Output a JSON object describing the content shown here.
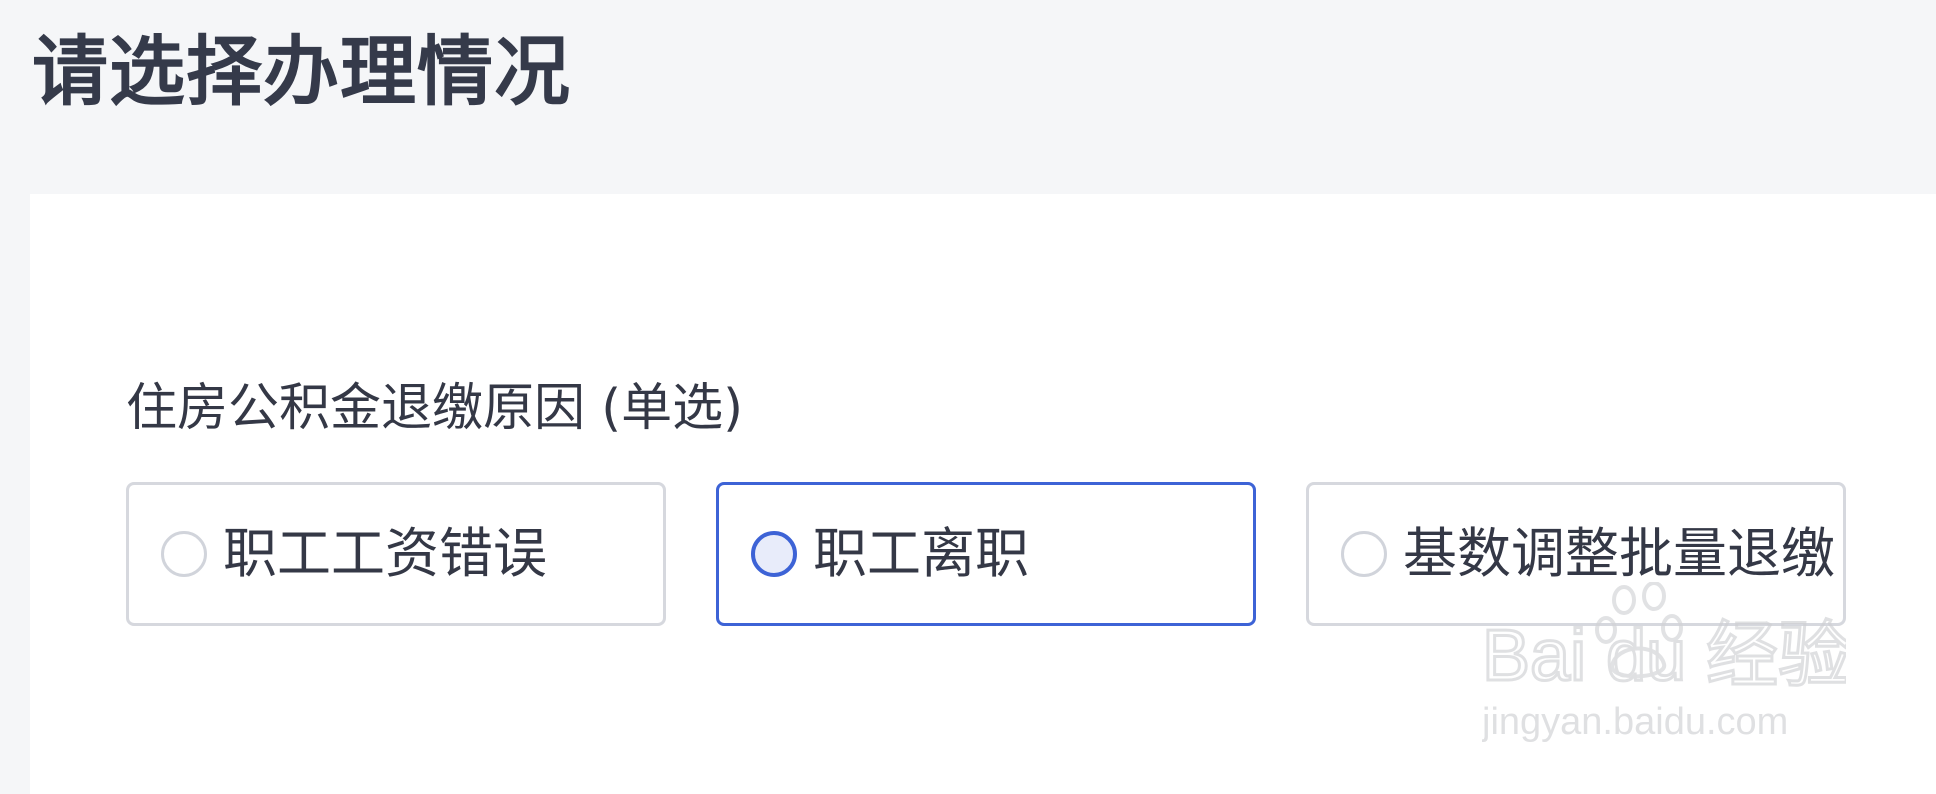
{
  "page": {
    "title": "请选择办理情况"
  },
  "form": {
    "question_label": "住房公积金退缴原因 (单选)",
    "options": [
      {
        "label": "职工工资错误",
        "selected": false
      },
      {
        "label": "职工离职",
        "selected": true
      },
      {
        "label": "基数调整批量退缴",
        "selected": false
      }
    ]
  },
  "watermark": {
    "brand": "Bai du 经验",
    "url": "jingyan.baidu.com"
  },
  "colors": {
    "accent": "#3d63d6",
    "background": "#f5f6f8",
    "card": "#ffffff",
    "text": "#343846",
    "border": "#d6d8de"
  }
}
